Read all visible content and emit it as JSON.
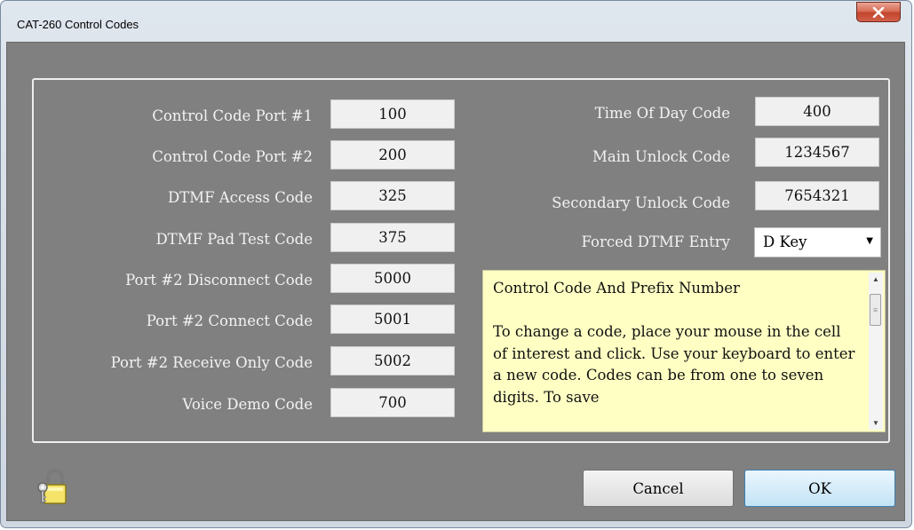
{
  "window": {
    "title": "CAT-260 Control Codes"
  },
  "left_fields": [
    {
      "label": "Control Code Port #1",
      "value": "100"
    },
    {
      "label": "Control Code Port #2",
      "value": "200"
    },
    {
      "label": "DTMF Access Code",
      "value": "325"
    },
    {
      "label": "DTMF Pad Test Code",
      "value": "375"
    },
    {
      "label": "Port #2 Disconnect Code",
      "value": "5000"
    },
    {
      "label": "Port #2 Connect Code",
      "value": "5001"
    },
    {
      "label": "Port #2 Receive Only Code",
      "value": "5002"
    },
    {
      "label": "Voice Demo Code",
      "value": "700"
    }
  ],
  "right_fields": [
    {
      "label": "Time Of Day Code",
      "value": "400"
    },
    {
      "label": "Main Unlock Code",
      "value": "1234567"
    },
    {
      "label": "Secondary Unlock Code",
      "value": "7654321"
    }
  ],
  "forced_dtmf": {
    "label": "Forced DTMF Entry",
    "selected": "D Key"
  },
  "help": {
    "heading": "Control Code And Prefix Number",
    "body": "To change a code, place your mouse in the cell of interest and click. Use your keyboard to enter a new code.  Codes can be from one to seven digits. To save"
  },
  "buttons": {
    "cancel": "Cancel",
    "ok": "OK"
  },
  "icons": {
    "close": "close-icon",
    "lock": "lock-keys-icon"
  }
}
